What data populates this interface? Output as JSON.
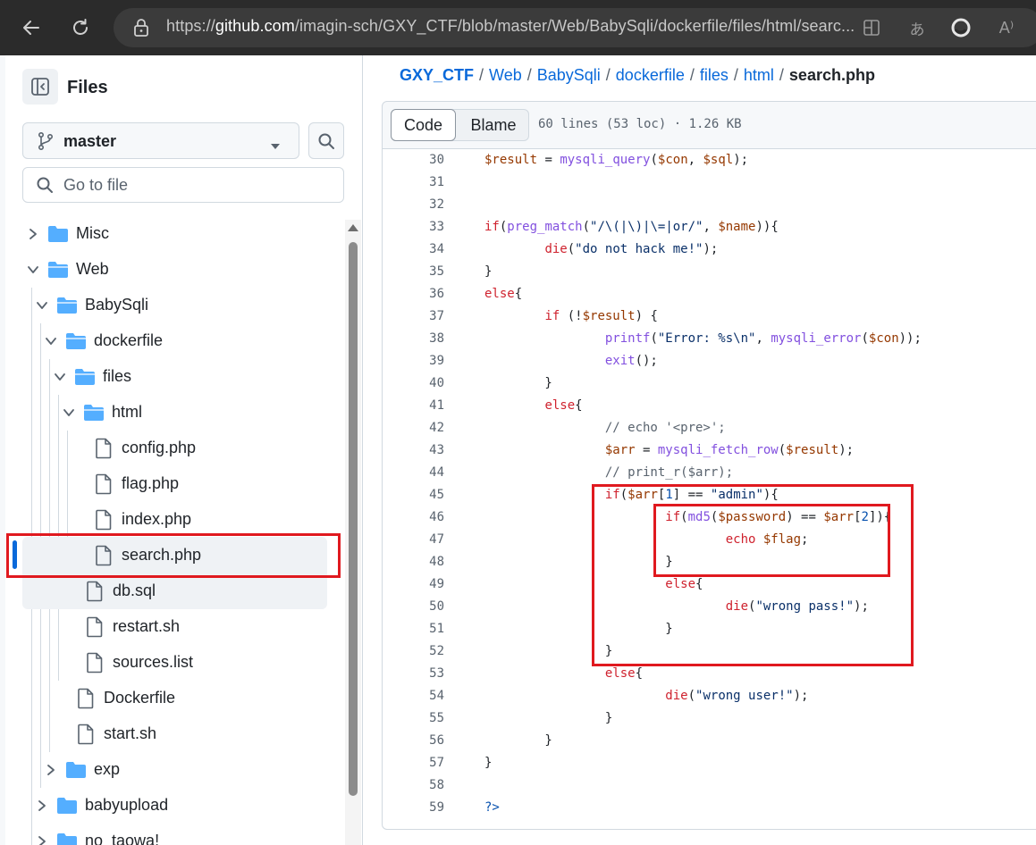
{
  "browser": {
    "url_prefix": "https://",
    "url_domain": "github.com",
    "url_path": "/imagin-sch/GXY_CTF/blob/master/Web/BabySqli/dockerfile/files/html/searc..."
  },
  "sidebar": {
    "title": "Files",
    "branch": "master",
    "goto_placeholder": "Go to file",
    "tree": [
      {
        "label": "Misc",
        "type": "folder",
        "expanded": false
      },
      {
        "label": "Web",
        "type": "folder",
        "expanded": true
      },
      {
        "label": "BabySqli",
        "type": "folder",
        "expanded": true
      },
      {
        "label": "dockerfile",
        "type": "folder",
        "expanded": true
      },
      {
        "label": "files",
        "type": "folder",
        "expanded": true
      },
      {
        "label": "html",
        "type": "folder",
        "expanded": true
      },
      {
        "label": "config.php",
        "type": "file"
      },
      {
        "label": "flag.php",
        "type": "file"
      },
      {
        "label": "index.php",
        "type": "file"
      },
      {
        "label": "search.php",
        "type": "file",
        "selected": true
      },
      {
        "label": "db.sql",
        "type": "file"
      },
      {
        "label": "restart.sh",
        "type": "file"
      },
      {
        "label": "sources.list",
        "type": "file"
      },
      {
        "label": "Dockerfile",
        "type": "file"
      },
      {
        "label": "start.sh",
        "type": "file"
      },
      {
        "label": "exp",
        "type": "folder",
        "expanded": false
      },
      {
        "label": "babyupload",
        "type": "folder",
        "expanded": false
      },
      {
        "label": "no_taowa!",
        "type": "folder",
        "expanded": false
      }
    ]
  },
  "breadcrumb": {
    "repo": "GXY_CTF",
    "parts": [
      "Web",
      "BabySqli",
      "dockerfile",
      "files",
      "html"
    ],
    "current": "search.php",
    "separator": "/"
  },
  "toolbar": {
    "code_label": "Code",
    "blame_label": "Blame",
    "meta": "60 lines (53 loc) · 1.26 KB"
  },
  "code": {
    "line_numbers": [
      "30",
      "31",
      "32",
      "33",
      "34",
      "35",
      "36",
      "37",
      "38",
      "39",
      "40",
      "41",
      "42",
      "43",
      "44",
      "45",
      "46",
      "47",
      "48",
      "49",
      "50",
      "51",
      "52",
      "53",
      "54",
      "55",
      "56",
      "57",
      "58",
      "59"
    ]
  },
  "colors": {
    "accent": "#0969da",
    "highlight_box": "#e0191f",
    "keyword": "#cf222e",
    "function": "#8250df",
    "string": "#0a3069"
  }
}
